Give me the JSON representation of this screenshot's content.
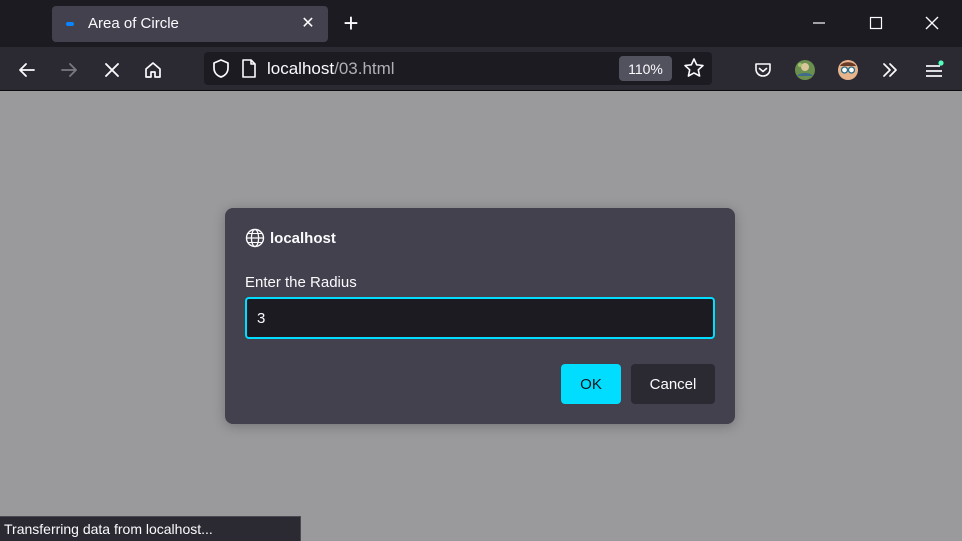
{
  "tab": {
    "title": "Area of Circle",
    "close": "✕",
    "new_tab": "+"
  },
  "window_controls": {
    "minimize": "minimize-icon",
    "maximize": "maximize-icon",
    "close": "close-icon"
  },
  "toolbar": {
    "back": "arrow-left-icon",
    "forward": "arrow-right-icon",
    "stop": "stop-icon",
    "home": "home-icon",
    "pocket": "pocket-icon",
    "extension_1": "extension-avatar-icon",
    "extension_2": "extension-glasses-icon",
    "overflow": "chevrons-right-icon",
    "menu": "hamburger-menu-icon"
  },
  "urlbar": {
    "host": "localhost",
    "path": "/03.html",
    "zoom": "110%"
  },
  "dialog": {
    "origin": "localhost",
    "label": "Enter the Radius",
    "input_value": "3",
    "ok_label": "OK",
    "cancel_label": "Cancel"
  },
  "status": {
    "text": "Transferring data from localhost..."
  },
  "colors": {
    "accent": "#00ddff",
    "tab_bg": "#42414d",
    "toolbar_bg": "#2b2a33",
    "page_overlay": "#9a9a9c",
    "favicon": "#0a84ff"
  }
}
